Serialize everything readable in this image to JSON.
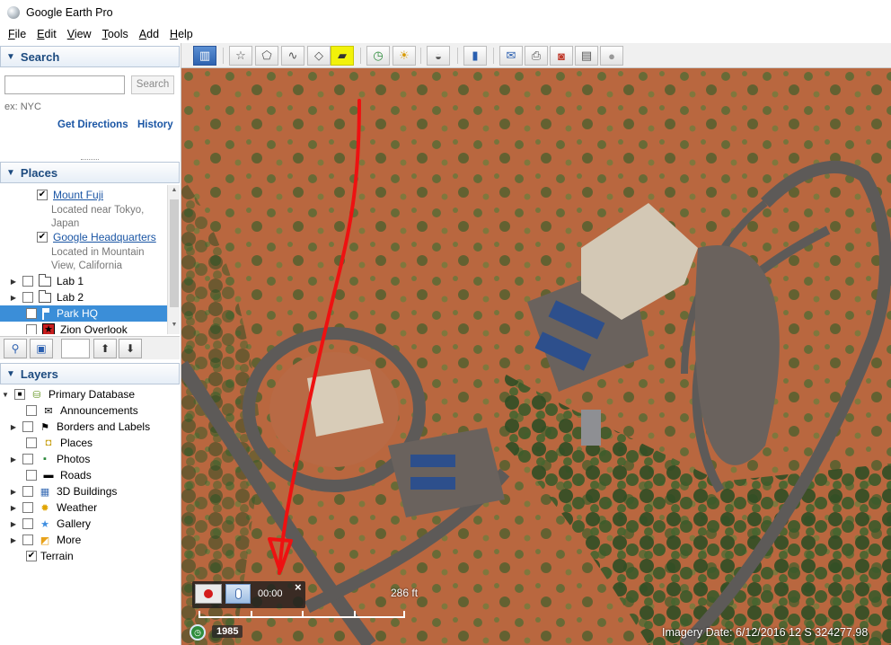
{
  "window": {
    "title": "Google Earth Pro"
  },
  "menu": [
    "File",
    "Edit",
    "View",
    "Tools",
    "Add",
    "Help"
  ],
  "search": {
    "header": "Search",
    "placeholder": "",
    "button": "Search",
    "hint": "ex: NYC",
    "get_directions": "Get Directions",
    "history": "History"
  },
  "places": {
    "header": "Places",
    "items": [
      {
        "label": "Mount Fuji",
        "sub": [
          "Located near Tokyo,",
          "Japan"
        ],
        "checked": true
      },
      {
        "label": "Google Headquarters",
        "sub": [
          "Located in Mountain",
          "View, California"
        ],
        "checked": true
      },
      {
        "label": "Lab 1",
        "checked": false
      },
      {
        "label": "Lab 2",
        "checked": false
      },
      {
        "label": "Park HQ",
        "checked": false,
        "selected": true
      },
      {
        "label": "Zion Overlook",
        "checked": false
      }
    ]
  },
  "layers": {
    "header": "Layers",
    "items": [
      {
        "label": "Primary Database",
        "icon": "database-icon"
      },
      {
        "label": "Announcements",
        "icon": "envelope-icon"
      },
      {
        "label": "Borders and Labels",
        "icon": "flag-icon"
      },
      {
        "label": "Places",
        "icon": "places-icon"
      },
      {
        "label": "Photos",
        "icon": "photo-icon"
      },
      {
        "label": "Roads",
        "icon": "road-icon"
      },
      {
        "label": "3D Buildings",
        "icon": "buildings-icon"
      },
      {
        "label": "Weather",
        "icon": "sun-icon"
      },
      {
        "label": "Gallery",
        "icon": "star-icon"
      },
      {
        "label": "More",
        "icon": "more-icon"
      },
      {
        "label": "Terrain",
        "icon": "terrain-icon",
        "checked": true
      }
    ]
  },
  "toolbar": {
    "highlighted_tool": "record-tour-icon",
    "accent": "#f2f20a"
  },
  "tour": {
    "time": "00:00",
    "close": "×"
  },
  "map": {
    "scale_label": "286 ft",
    "historical_year": "1985",
    "status": "Imagery Date: 6/12/2016      12 S 324277.98"
  }
}
